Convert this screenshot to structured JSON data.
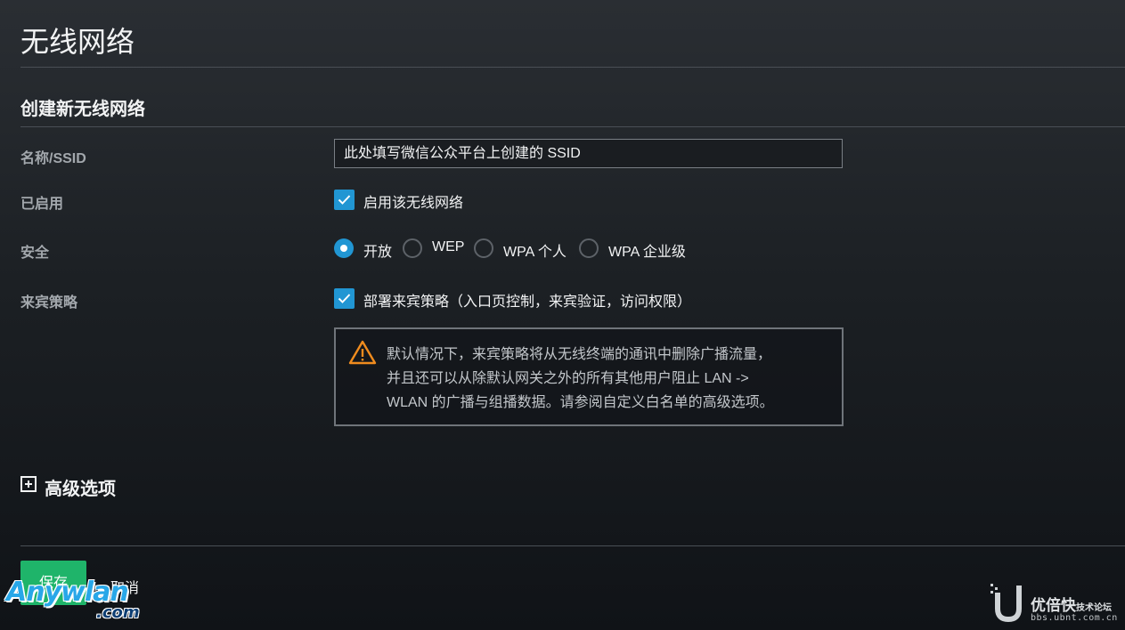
{
  "page_title": "无线网络",
  "section_title": "创建新无线网络",
  "rows": {
    "ssid_label": "名称/SSID",
    "enabled_label": "已启用",
    "security_label": "安全",
    "guest_label": "来宾策略"
  },
  "ssid_value": "此处填写微信公众平台上创建的 SSID",
  "enabled_checkbox": {
    "label": "启用该无线网络",
    "checked": true
  },
  "security_options": [
    {
      "label": "开放",
      "selected": true
    },
    {
      "label": "WEP",
      "selected": false
    },
    {
      "label": "WPA 个人",
      "selected": false
    },
    {
      "label": "WPA 企业级",
      "selected": false
    }
  ],
  "guest_checkbox": {
    "label": "部署来宾策略（入口页控制，来宾验证，访问权限）",
    "checked": true
  },
  "warning": {
    "lines": [
      "默认情况下，来宾策略将从无线终端的通讯中删除广播流量，",
      "并且还可以从除默认网关之外的所有其他用户阻止 LAN ->",
      "WLAN 的广播与组播数据。请参阅自定义白名单的高级选项。"
    ],
    "icon": "warning-triangle-icon",
    "icon_color": "#f08c1e"
  },
  "advanced_label": "高级选项",
  "buttons": {
    "save": "保存",
    "cancel": "取消"
  },
  "watermarks": {
    "left_main": "Anywlan",
    "left_sub": ".com",
    "right_main": "优倍快",
    "right_small": "技术论坛",
    "right_url": "bbs.ubnt.com.cn"
  },
  "colors": {
    "accent": "#2196d3",
    "save_button": "#1fb46a",
    "background": "#1c2024"
  }
}
